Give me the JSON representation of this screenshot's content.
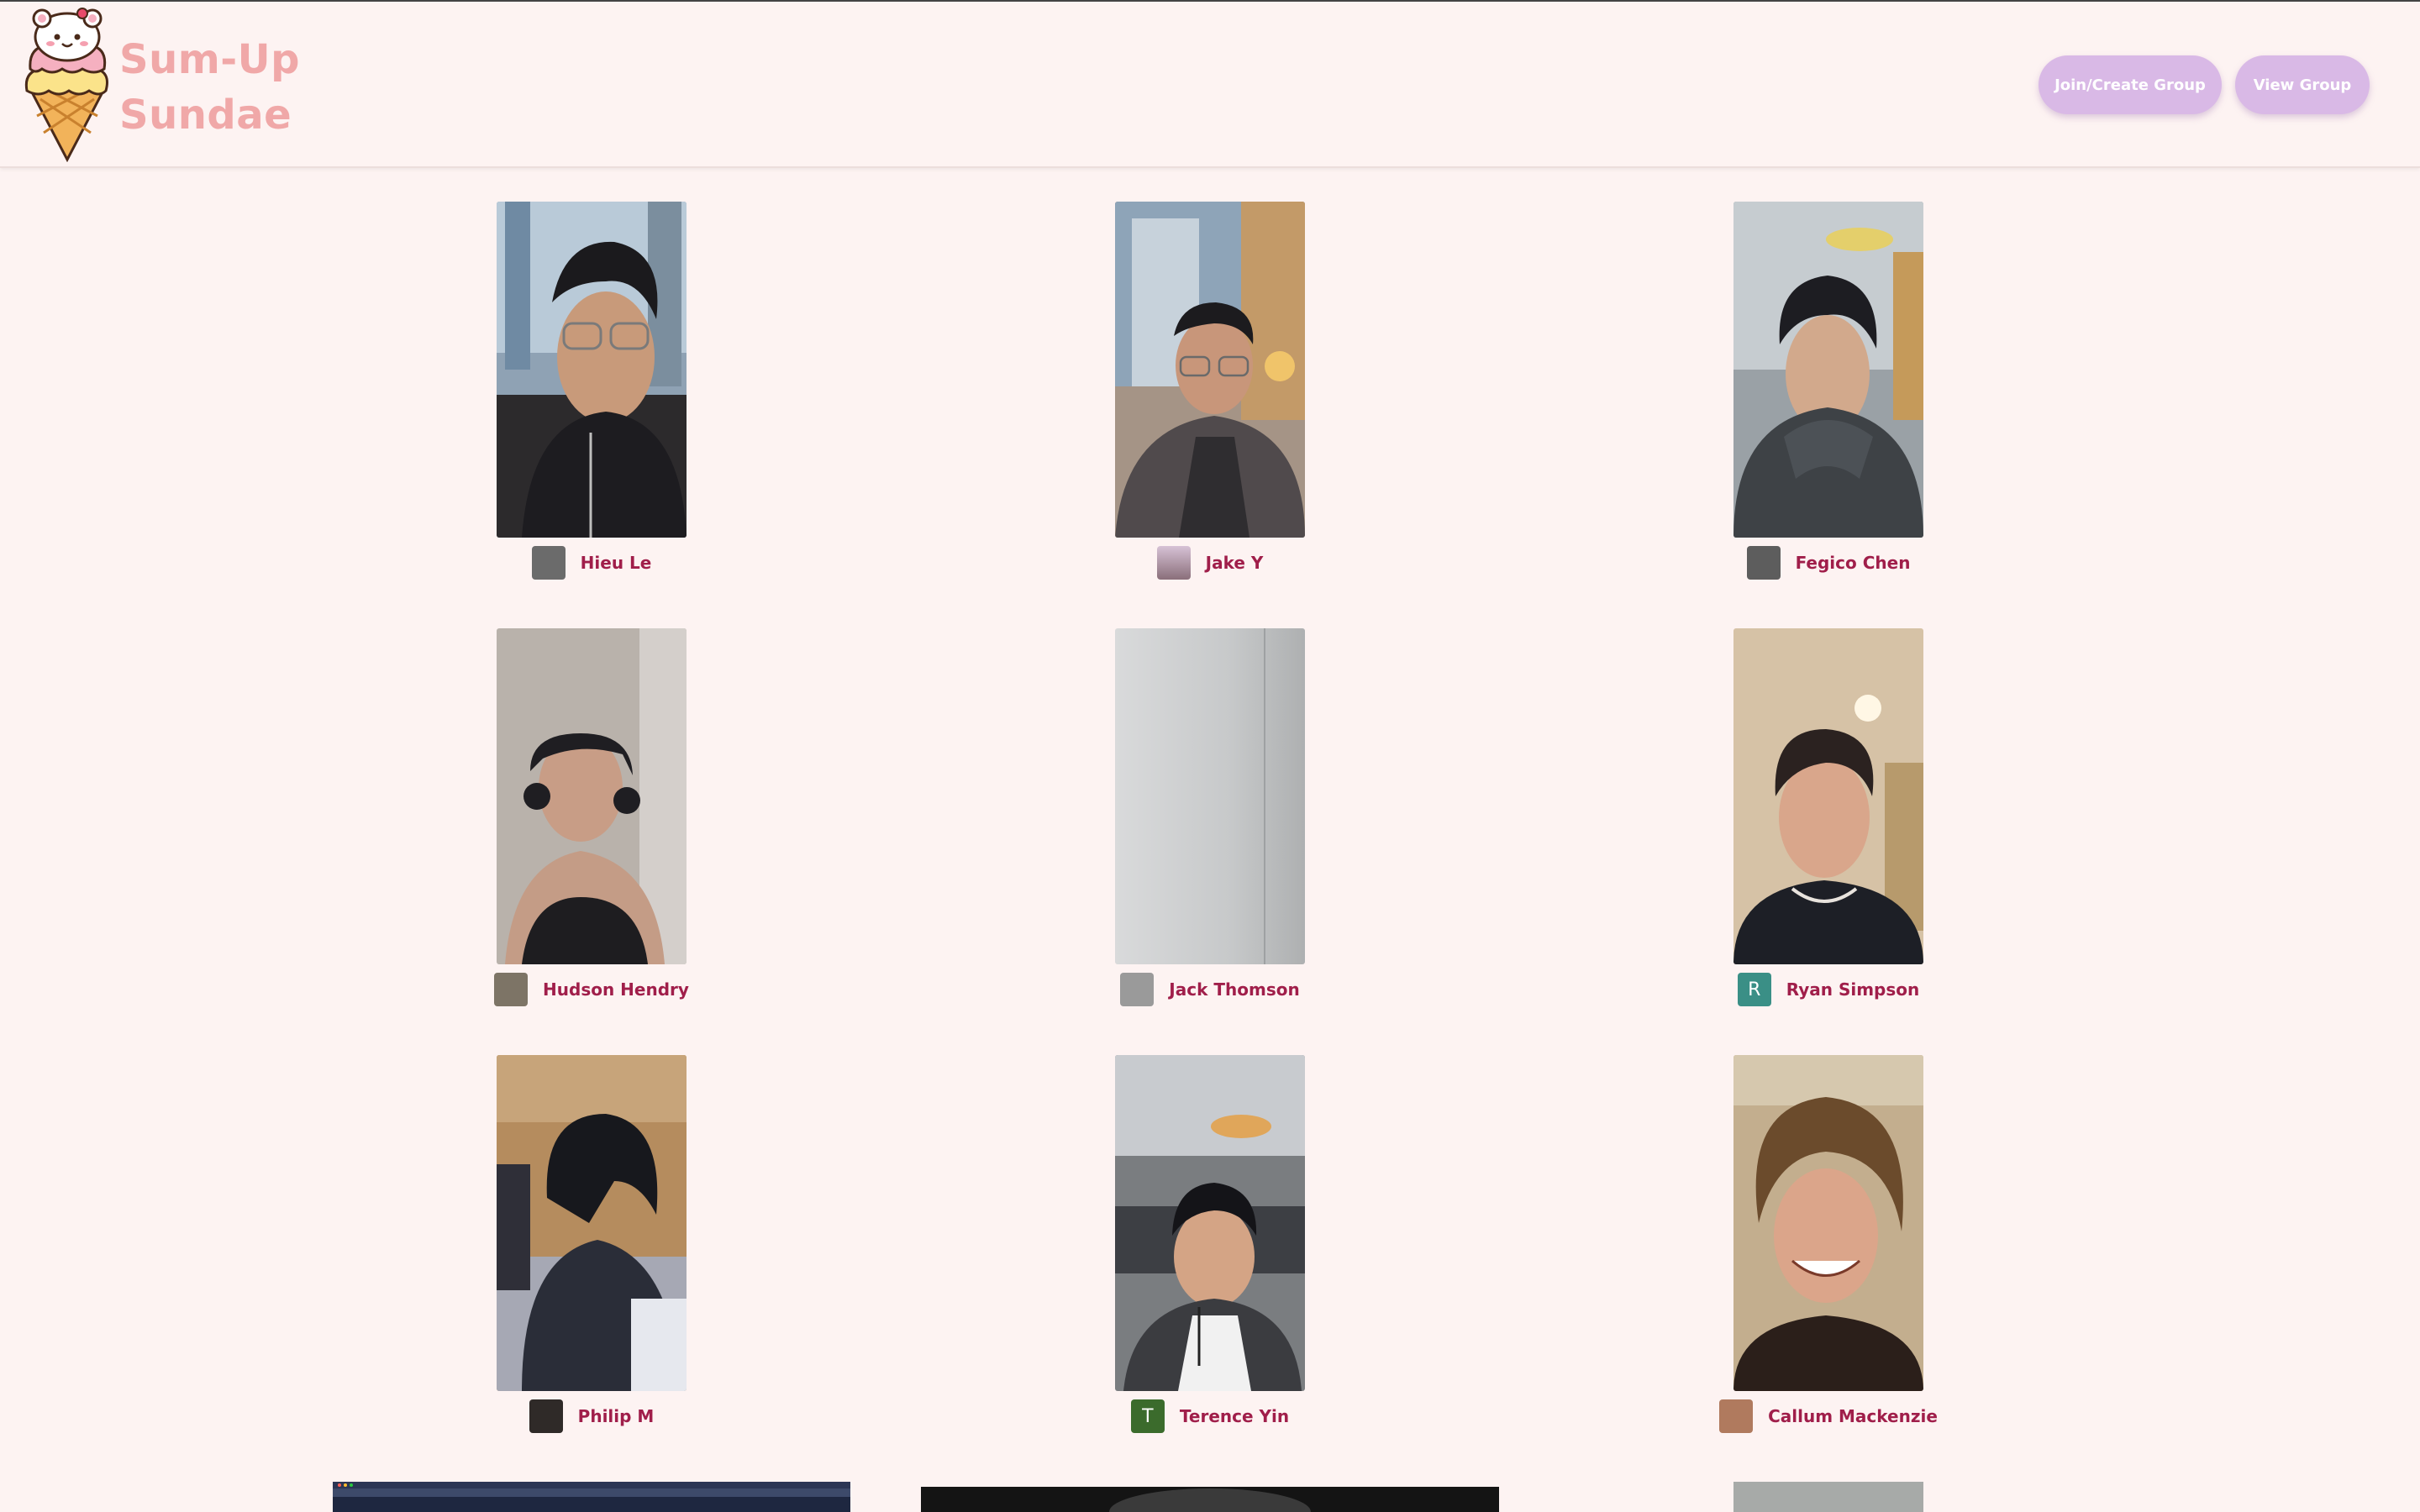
{
  "app": {
    "title_line1": "Sum-Up",
    "title_line2": "Sundae"
  },
  "header": {
    "join_button": "Join/Create Group",
    "view_button": "View Group"
  },
  "participants": [
    {
      "name": "Hieu Le",
      "avatar_type": "photo",
      "avatar_color": "#6b6b6b"
    },
    {
      "name": "Jake Y",
      "avatar_type": "photo",
      "avatar_color": "#b7a2b8"
    },
    {
      "name": "Fegico Chen",
      "avatar_type": "photo",
      "avatar_color": "#5d5d5d"
    },
    {
      "name": "Hudson Hendry",
      "avatar_type": "photo",
      "avatar_color": "#7d7466"
    },
    {
      "name": "Jack Thomson",
      "avatar_type": "photo",
      "avatar_color": "#9a9a9a"
    },
    {
      "name": "Ryan Simpson",
      "avatar_type": "letter",
      "avatar_letter": "R",
      "avatar_color": "#3a8f86"
    },
    {
      "name": "Philip M",
      "avatar_type": "photo",
      "avatar_color": "#2f2a28"
    },
    {
      "name": "Terence Yin",
      "avatar_type": "letter",
      "avatar_letter": "T",
      "avatar_color": "#3b6b2c"
    },
    {
      "name": "Callum Mackenzie",
      "avatar_type": "photo",
      "avatar_color": "#b07a5e"
    }
  ],
  "colors": {
    "background": "#fdf3f2",
    "accent_button": "#d9b9e6",
    "name_text": "#a01e4a",
    "logo_text": "#f0a8a8"
  }
}
